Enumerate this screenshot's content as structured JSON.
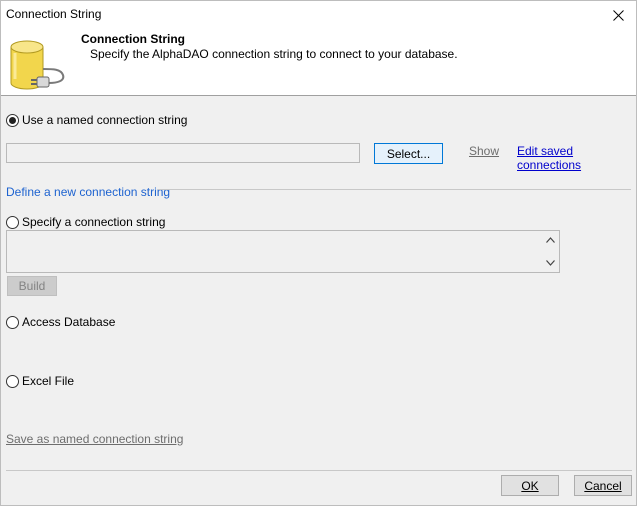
{
  "window": {
    "title": "Connection String"
  },
  "header": {
    "title": "Connection String",
    "subtitle": "Specify the AlphaDAO connection string to connect to your database.",
    "icon": "database-plug-icon"
  },
  "named": {
    "radio_label": "Use a named connection string",
    "selected": true,
    "input_value": "",
    "select_button": "Select...",
    "show_link": "Show",
    "edit_link": "Edit saved connections"
  },
  "define_section": {
    "label": "Define a new connection string"
  },
  "specify": {
    "radio_label": "Specify a connection string",
    "textarea_value": "",
    "build_button": "Build"
  },
  "access": {
    "radio_label": "Access Database"
  },
  "excel": {
    "radio_label": "Excel File"
  },
  "save_link": "Save as named connection string",
  "buttons": {
    "ok": "OK",
    "cancel": "Cancel"
  },
  "colors": {
    "accent_link": "#0000cc",
    "section_label": "#1e63d0",
    "primary_border": "#0078d7",
    "icon_yellow": "#f2d64c"
  }
}
